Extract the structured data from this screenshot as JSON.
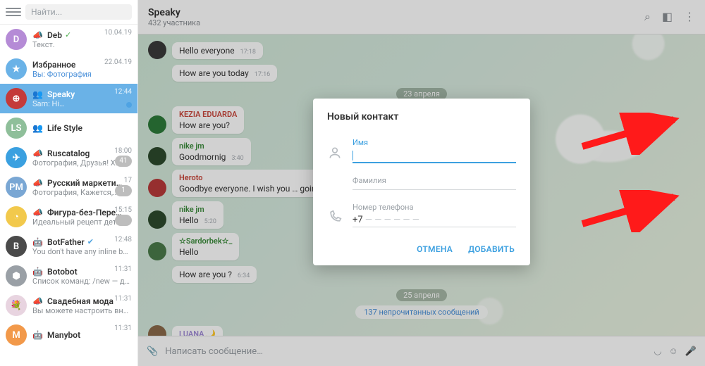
{
  "sidebar": {
    "search_placeholder": "Найти...",
    "chats": [
      {
        "title": "Deb",
        "sub": "Текст.",
        "time": "10.04.19",
        "checked": true,
        "avatar": "D",
        "color": "#b58bd6",
        "icon": "📣"
      },
      {
        "title": "Избранное",
        "sub": "Вы: Фотография",
        "time": "22.04.19",
        "avatar": "★",
        "color": "#6ab2e7",
        "subColor": "#4a90d9"
      },
      {
        "title": "Speaky",
        "sub": "Sam: Hi…",
        "time": "12:44",
        "avatar": "⊕",
        "color": "#c43a3a",
        "active": true,
        "badge": "",
        "badgeDot": true,
        "icon": "👥"
      },
      {
        "title": "Life Style",
        "sub": "",
        "time": "",
        "avatar": "LS",
        "color": "#8fbf9a",
        "icon": "👥"
      },
      {
        "title": "Ruscatalog",
        "sub": "Фотография, Друзья! Х…",
        "time": "18:00",
        "avatar": "✈",
        "color": "#3aa0e0",
        "badge": "41",
        "icon": "📣"
      },
      {
        "title": "Русский маркети…",
        "sub": "Фотография, Кажется,…",
        "time": "17",
        "avatar": "PM",
        "color": "#7aa7d4",
        "badge": "1",
        "icon": "📣"
      },
      {
        "title": "Фигура-без-Пере…",
        "sub": "Идеальный рецепт дет…",
        "time": "15:15",
        "avatar": "◔",
        "color": "#f2c94c",
        "badge": "",
        "icon": "📣"
      },
      {
        "title": "BotFather",
        "sub": "You don't have any inline bo…",
        "time": "12:48",
        "avatar": "B",
        "color": "#4a4a4a",
        "verified": true,
        "icon": "🤖"
      },
      {
        "title": "Botobot",
        "sub": "Список команд: /new — доб…",
        "time": "11:31",
        "avatar": "⬢",
        "color": "#9aa0a6",
        "icon": "🤖"
      },
      {
        "title": "Свадебная мода",
        "sub": "Вы можете настроить вне…",
        "time": "11:31",
        "avatar": "💐",
        "color": "#e8d4e0",
        "icon": "📣"
      },
      {
        "title": "Manybot",
        "sub": "",
        "time": "11:31",
        "avatar": "M",
        "color": "#f2994a",
        "icon": "🤖"
      }
    ]
  },
  "header": {
    "title": "Speaky",
    "sub": "432 участника"
  },
  "dates": {
    "d1": "23 апреля",
    "d2": "25 апреля"
  },
  "unread": "137 непрочитанных сообщений",
  "messages": [
    {
      "author": "",
      "authorColor": "",
      "text": "Hello everyone",
      "time": "17:18",
      "av": "#3a3a3a"
    },
    {
      "author": "",
      "authorColor": "",
      "text": "How are you today",
      "time": "17:16",
      "av": "#3a3a3a",
      "cont": true
    },
    {
      "author": "KEZIA EDUARDA",
      "authorColor": "#c9453a",
      "text": "How are you?",
      "time": "",
      "av": "#2d7a3a"
    },
    {
      "author": "nike jm",
      "authorColor": "#3a8a3a",
      "text": "Goodmornig",
      "time": "3:40",
      "av": "#2d4a2d"
    },
    {
      "author": "Heroto",
      "authorColor": "#c9453a",
      "text": "Goodbye everyone. I wish you … going to sleep.",
      "time": "",
      "av": "#b83a3a"
    },
    {
      "author": "nike jm",
      "authorColor": "#3a8a3a",
      "text": "Hello",
      "time": "5:20",
      "av": "#2d4a2d"
    },
    {
      "author": "☆Sardorbek☆_",
      "authorColor": "#3a8a3a",
      "text": "Hello",
      "time": "",
      "av": "#4a7a4a"
    },
    {
      "author": "",
      "authorColor": "",
      "text": "How are you ?",
      "time": "6:34",
      "av": "#bda0a0",
      "cont": true
    },
    {
      "author": "LUANA 🌙",
      "authorColor": "#a08bd6",
      "text": "",
      "time": "",
      "av": "#8a6a4a",
      "nameOnly": true
    }
  ],
  "composer": {
    "placeholder": "Написать сообщение…"
  },
  "modal": {
    "title": "Новый контакт",
    "name_label": "Имя",
    "surname_label": "Фамилия",
    "phone_label": "Номер телефона",
    "phone_value": "+7",
    "cancel": "ОТМЕНА",
    "add": "ДОБАВИТЬ"
  }
}
